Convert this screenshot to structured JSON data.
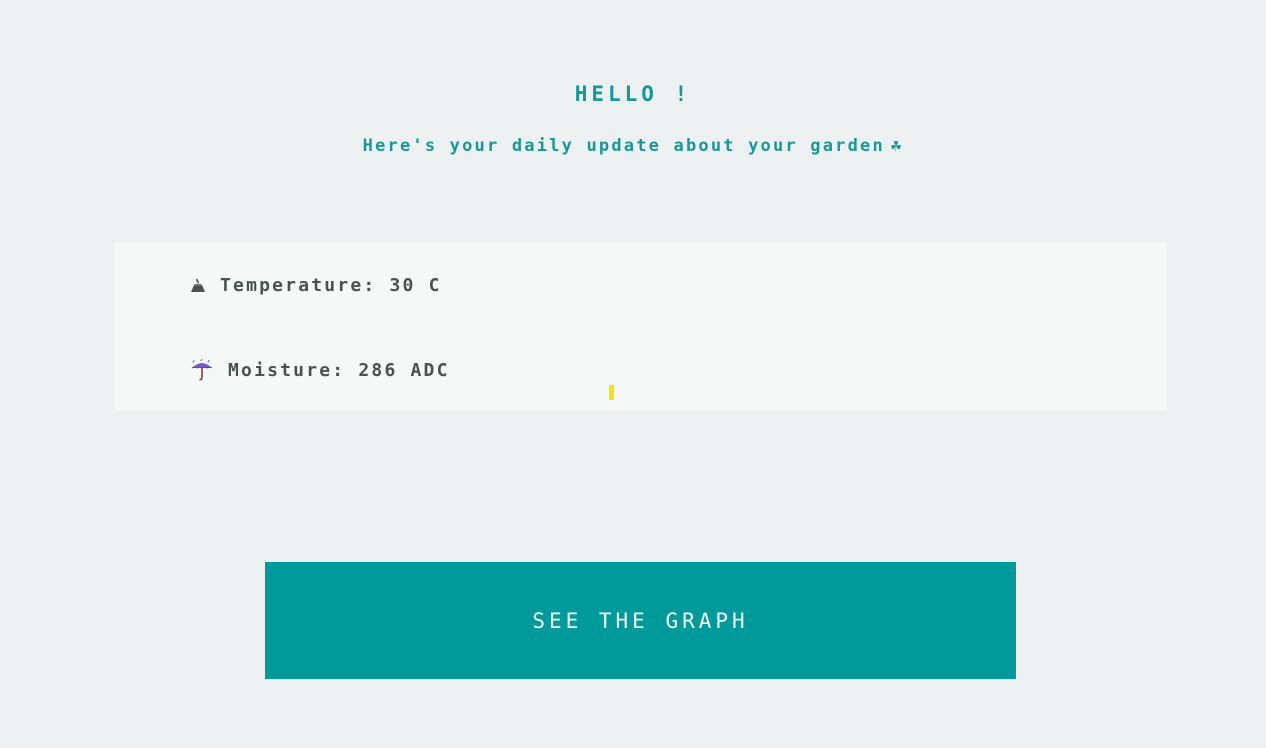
{
  "header": {
    "greeting": "HELLO !",
    "subtitle": "Here's your daily update about your garden",
    "subtitle_emoji": "☘"
  },
  "readings": {
    "temperature": {
      "icon": "volcano-icon",
      "label": "Temperature: 30 C"
    },
    "moisture": {
      "icon": "umbrella-rain-icon",
      "label": "Moisture: 286 ADC"
    }
  },
  "actions": {
    "graph_button_label": "SEE THE GRAPH"
  },
  "colors": {
    "accent": "#009a9c",
    "heading": "#17989a",
    "text": "#4a5151",
    "background": "#ecf0f1",
    "panel": "#f6f8f8",
    "marker": "#f0e40c"
  }
}
